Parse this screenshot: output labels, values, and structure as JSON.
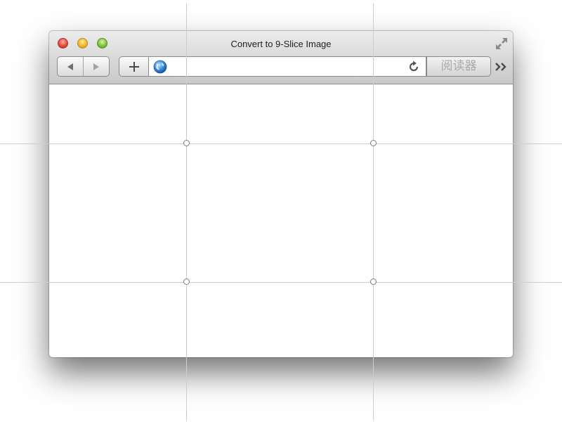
{
  "window": {
    "title": "Convert to 9-Slice Image"
  },
  "toolbar": {
    "back_icon": "back-arrow-icon",
    "forward_icon": "forward-arrow-icon",
    "add_icon": "plus-icon",
    "address": {
      "value": "",
      "placeholder": ""
    },
    "reader_label": "阅读器"
  },
  "colors": {
    "guide_line": "#cdcdcd",
    "close": "#e8473b",
    "minimize": "#f2b52e",
    "zoom": "#7fc43a"
  }
}
